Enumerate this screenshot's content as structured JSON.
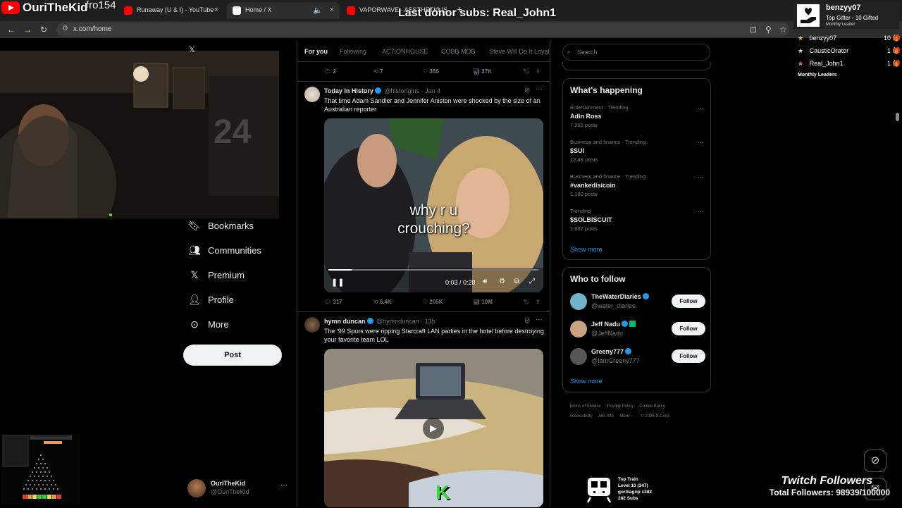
{
  "browser": {
    "tabs": [
      {
        "title": "Runaway (U & I) - YouTube",
        "color": "#ff0000"
      },
      {
        "title": "Home / X",
        "color": "#ffffff"
      },
      {
        "title": "VAPORWAVE - AESTHETIC [SYN",
        "color": "#ff0000"
      }
    ],
    "new_tab": "+",
    "url": "x.com/home"
  },
  "stream_overlay": {
    "streamer_name": "OuriTheKid",
    "ghost_text": "fro154",
    "last_donor": "Last donor subs: Real_John1",
    "leaderboard": {
      "top_name": "benzyy07",
      "top_sub": "Top Gifter - 10 Gifted",
      "top_tag": "Monthly Leader",
      "rows": [
        {
          "name": "benzyy07",
          "count": "10",
          "star_color": "#f5c542"
        },
        {
          "name": "CausticOrator",
          "count": "1",
          "star_color": "#dddddd"
        },
        {
          "name": "Real_John1",
          "count": "1",
          "star_color": "#e8803a"
        }
      ],
      "footer": "Monthly Leaders"
    },
    "webcam_jersey": "24",
    "train": {
      "title": "Top Train",
      "level": "Level 10  (347)",
      "user": "gorillagrip x282",
      "subs": "282 Subs"
    },
    "twitch_title": "Twitch Followers",
    "twitch_total": "Total Followers: 98939/100000"
  },
  "left_nav": {
    "items": [
      {
        "label": "Bookmarks",
        "icon": "bookmark-icon",
        "glyph": "🔖"
      },
      {
        "label": "Communities",
        "icon": "communities-icon",
        "glyph": "👥"
      },
      {
        "label": "Premium",
        "icon": "x-logo-icon",
        "glyph": "𝕏"
      },
      {
        "label": "Profile",
        "icon": "profile-icon",
        "glyph": "👤"
      },
      {
        "label": "More",
        "icon": "more-circle-icon",
        "glyph": "⋯"
      }
    ],
    "post_label": "Post",
    "account_name": "OuriTheKid",
    "account_handle": "@OuriTheKid"
  },
  "timeline": {
    "tabs": [
      "For you",
      "Following",
      "AC7IONHOUSE",
      "COBB MOB",
      "Steve Will Do It Loyal"
    ],
    "prev_actions": {
      "replies": "2",
      "reposts": "7",
      "likes": "360",
      "views": "27K"
    },
    "tweets": [
      {
        "name": "Today In History",
        "handle": "@historigins",
        "time": "Jan 4",
        "text": "That time Adam Sandler and Jennifer Aniston were shocked by the size of an Australian reporter",
        "caption": "why r u\ncrouching?",
        "video_time": "0:03 / 0:28",
        "progress": 0.11,
        "actions": {
          "replies": "317",
          "reposts": "6.4K",
          "likes": "205K",
          "views": "10M"
        }
      },
      {
        "name": "hymn duncan",
        "handle": "@hymnduncan",
        "time": "13h",
        "text": "The '99 Spurs were ripping Starcraft LAN parties in the hotel before destroying your favorite team LOL",
        "watermark": "K"
      }
    ]
  },
  "right_column": {
    "search_placeholder": "Search",
    "whats_happening": "What's happening",
    "trends": [
      {
        "category": "Entertainment · Trending",
        "name": "Adin Ross",
        "count": "7,965 posts"
      },
      {
        "category": "Business and finance · Trending",
        "name": "$SUI",
        "count": "12.4K posts"
      },
      {
        "category": "Business and finance · Trending",
        "name": "#vankedisicoin",
        "count": "1,180 posts"
      },
      {
        "category": "Trending",
        "name": "$SOLBISCUIT",
        "count": "1,637 posts"
      }
    ],
    "show_more": "Show more",
    "who_to_follow": "Who to follow",
    "suggestions": [
      {
        "name": "TheWaterDiaries",
        "handle": "@water_diaries",
        "avatar_color": "#6fb3c8"
      },
      {
        "name": "Jeff Nadu",
        "handle": "@JeffNadu",
        "avatar_color": "#c9a27f"
      },
      {
        "name": "Greeny777",
        "handle": "@IamGreeny777",
        "avatar_color": "#555555"
      }
    ],
    "follow_label": "Follow",
    "footer_links": [
      "Terms of Service",
      "Privacy Policy",
      "Cookie Policy",
      "Accessibility",
      "Ads info",
      "More ···",
      "© 2025 X Corp."
    ]
  }
}
